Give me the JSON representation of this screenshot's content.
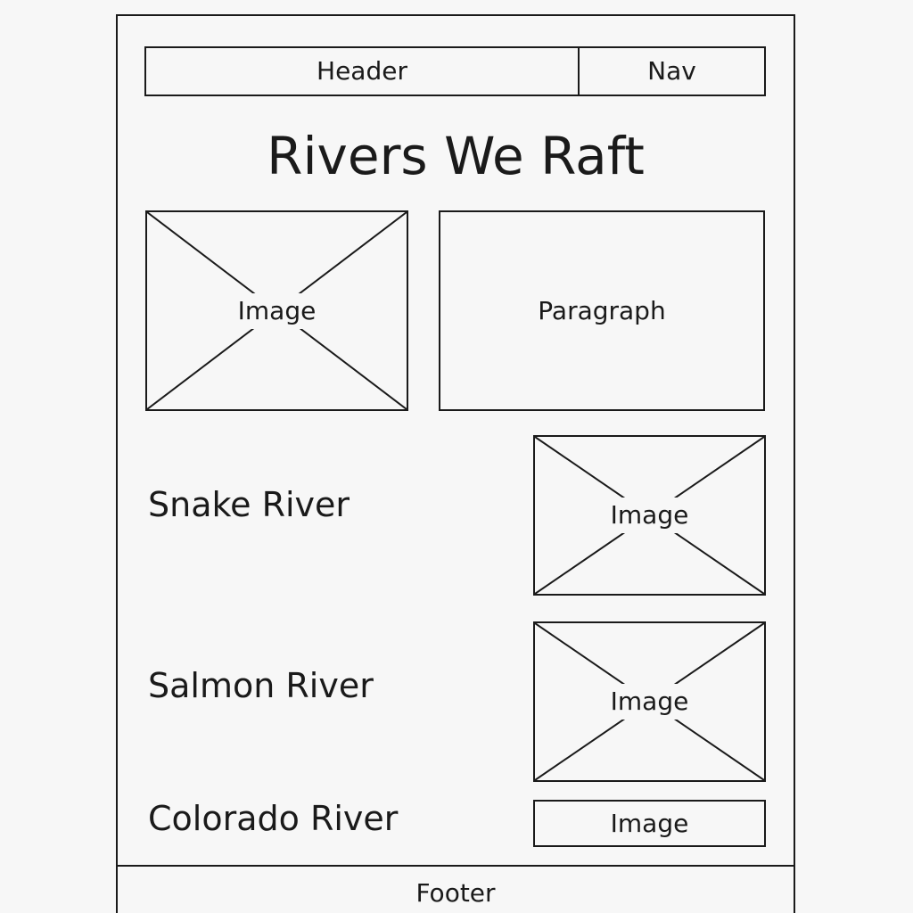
{
  "header": {
    "label": "Header",
    "nav_label": "Nav"
  },
  "title": "Rivers We Raft",
  "intro": {
    "image_label": "Image",
    "paragraph_label": "Paragraph"
  },
  "rivers": [
    {
      "name": "Snake River",
      "image_label": "Image"
    },
    {
      "name": "Salmon River",
      "image_label": "Image"
    },
    {
      "name": "Colorado River",
      "image_label": "Image"
    }
  ],
  "footer": {
    "label": "Footer"
  }
}
